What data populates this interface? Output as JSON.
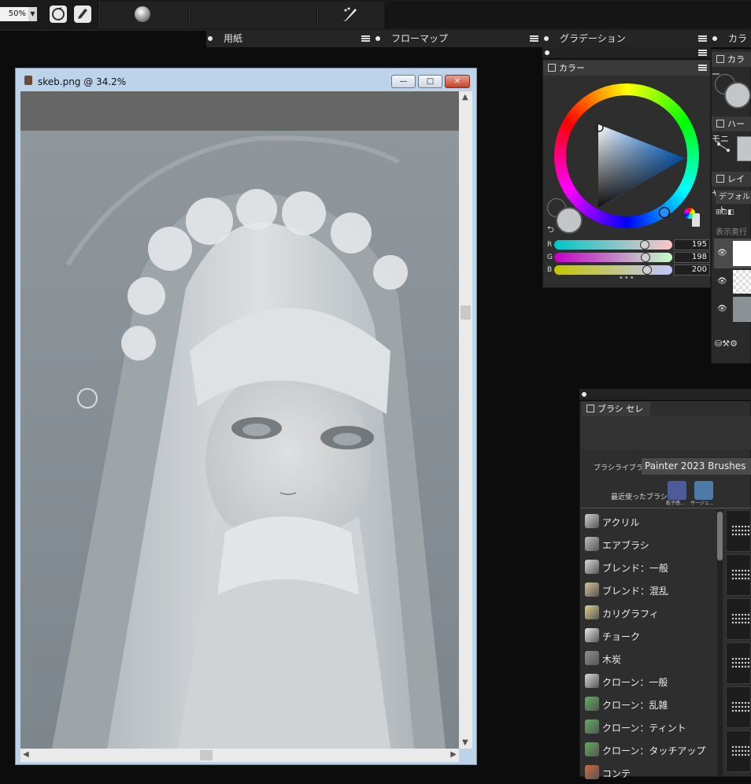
{
  "toolbar": {
    "zoom_value": "50%"
  },
  "palette_tabs": [
    {
      "label": "用紙"
    },
    {
      "label": "フローマップ"
    },
    {
      "label": "グラデーション"
    },
    {
      "label": "カラー..."
    }
  ],
  "document": {
    "title": "skeb.png @ 34.2%",
    "minimize": "—",
    "maximize": "□",
    "close": "✕"
  },
  "color_panel": {
    "title": "カラー",
    "r_label": "R",
    "g_label": "G",
    "b_label": "B",
    "r_value": "195",
    "g_value": "198",
    "b_value": "200",
    "current_color": "#c3c6c8",
    "r_fraction": 0.765,
    "g_fraction": 0.776,
    "b_fraction": 0.784
  },
  "right_panels": {
    "color_title": "カラー",
    "harmony_title": "ハーモニ",
    "layers_title": "レイヤー",
    "layers_default": "デフォルト",
    "layers_order": "表示奥行き"
  },
  "brush_selector": {
    "title": "ブラシ セレクタ",
    "library_label": "ブラシライブラリ:",
    "library_value": "Painter 2023 Brushes",
    "recent_label": "最近使ったブラシ:",
    "recent": [
      {
        "caption": "乾子感..."
      },
      {
        "caption": "サージェ..."
      }
    ],
    "categories": [
      {
        "label": "アクリル"
      },
      {
        "label": "エアブラシ"
      },
      {
        "label": "ブレンド：一般"
      },
      {
        "label": "ブレンド：混乱"
      },
      {
        "label": "カリグラフィ"
      },
      {
        "label": "チョーク"
      },
      {
        "label": "木炭"
      },
      {
        "label": "クローン：一般"
      },
      {
        "label": "クローン：乱雑"
      },
      {
        "label": "クローン：ティント"
      },
      {
        "label": "クローン：タッチアップ"
      },
      {
        "label": "コンテ"
      }
    ]
  }
}
